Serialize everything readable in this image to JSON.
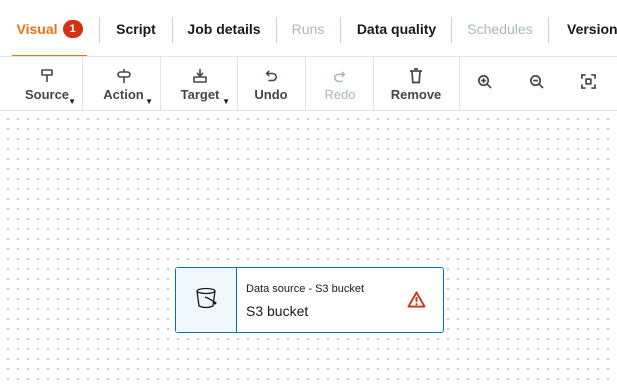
{
  "tabs": [
    {
      "label": "Visual",
      "badge": "1",
      "state": "active"
    },
    {
      "label": "Script",
      "state": "normal"
    },
    {
      "label": "Job details",
      "state": "normal"
    },
    {
      "label": "Runs",
      "state": "disabled"
    },
    {
      "label": "Data quality",
      "state": "normal"
    },
    {
      "label": "Schedules",
      "state": "disabled"
    },
    {
      "label": "Version C",
      "state": "normal"
    }
  ],
  "toolbar": {
    "source_label": "Source",
    "action_label": "Action",
    "target_label": "Target",
    "undo_label": "Undo",
    "redo_label": "Redo",
    "remove_label": "Remove",
    "icons": {
      "source": "source-node-icon",
      "action": "action-node-icon",
      "target": "target-node-icon",
      "undo": "undo-icon",
      "redo": "redo-icon",
      "remove": "trash-icon",
      "zoom_in": "zoom-in-icon",
      "zoom_out": "zoom-out-icon",
      "fit": "fit-to-screen-icon"
    }
  },
  "canvas": {
    "nodes": [
      {
        "type_label": "Data source - S3 bucket",
        "name": "S3 bucket",
        "icon": "bucket-icon",
        "status_icon": "warning-icon"
      }
    ]
  },
  "colors": {
    "accent": "#ec7211",
    "badge": "#d13212",
    "node_border": "#0073bb",
    "node_icon_bg": "#f1f8fd",
    "warning": "#d13212"
  }
}
